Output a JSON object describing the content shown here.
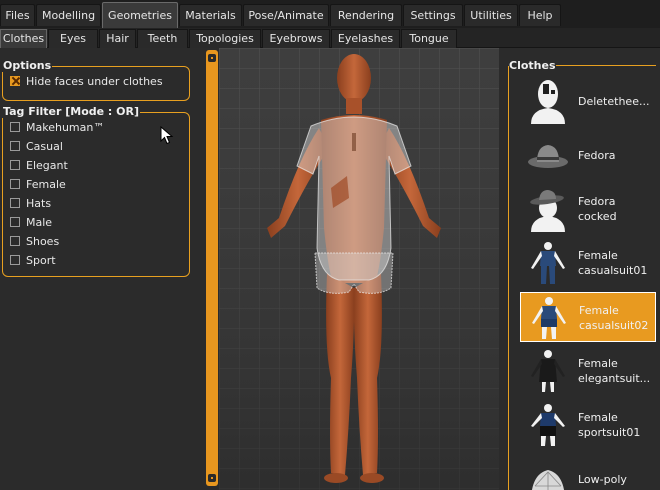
{
  "main_tabs": [
    {
      "label": "Files",
      "active": false
    },
    {
      "label": "Modelling",
      "active": false
    },
    {
      "label": "Geometries",
      "active": true
    },
    {
      "label": "Materials",
      "active": false
    },
    {
      "label": "Pose/Animate",
      "active": false
    },
    {
      "label": "Rendering",
      "active": false
    },
    {
      "label": "Settings",
      "active": false
    },
    {
      "label": "Utilities",
      "active": false
    },
    {
      "label": "Help",
      "active": false
    }
  ],
  "sub_tabs": [
    {
      "label": "Clothes",
      "active": true
    },
    {
      "label": "Eyes",
      "active": false
    },
    {
      "label": "Hair",
      "active": false
    },
    {
      "label": "Teeth",
      "active": false
    },
    {
      "label": "Topologies",
      "active": false
    },
    {
      "label": "Eyebrows",
      "active": false
    },
    {
      "label": "Eyelashes",
      "active": false
    },
    {
      "label": "Tongue",
      "active": false
    }
  ],
  "options": {
    "title": "Options",
    "hide_faces": {
      "label": "Hide faces under clothes",
      "checked": true
    }
  },
  "tag_filter": {
    "title": "Tag Filter [Mode : OR]",
    "tags": [
      {
        "label": "Makehuman™",
        "checked": false
      },
      {
        "label": "Casual",
        "checked": false
      },
      {
        "label": "Elegant",
        "checked": false
      },
      {
        "label": "Female",
        "checked": false
      },
      {
        "label": "Hats",
        "checked": false
      },
      {
        "label": "Male",
        "checked": false
      },
      {
        "label": "Shoes",
        "checked": false
      },
      {
        "label": "Sport",
        "checked": false
      }
    ]
  },
  "clothes_panel": {
    "title": "Clothes",
    "items": [
      {
        "label": "Deletethee...",
        "icon": "delete-head-icon",
        "selected": false
      },
      {
        "label": "Fedora",
        "icon": "fedora-icon",
        "selected": false
      },
      {
        "label": "Fedora\ncocked",
        "icon": "fedora-cocked-icon",
        "selected": false
      },
      {
        "label": "Female\ncasualsuit01",
        "icon": "casualsuit-icon",
        "selected": false
      },
      {
        "label": "Female\ncasualsuit02",
        "icon": "casualsuit-icon",
        "selected": true
      },
      {
        "label": "Female\nelegantsuit...",
        "icon": "elegantsuit-icon",
        "selected": false
      },
      {
        "label": "Female\nsportsuit01",
        "icon": "sportsuit-icon",
        "selected": false
      },
      {
        "label": "Low-poly",
        "icon": "lowpoly-icon",
        "selected": false
      }
    ]
  },
  "colors": {
    "accent": "#e89a20",
    "background": "#2b2b2b",
    "viewport": "#3d3d3d",
    "skin": "#b05a2e"
  }
}
